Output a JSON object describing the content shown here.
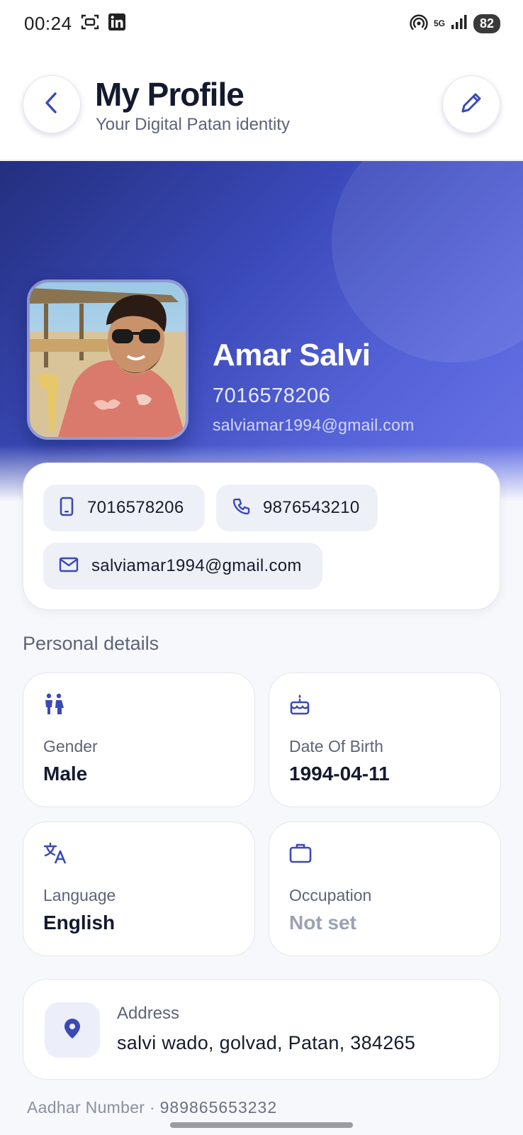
{
  "status_bar": {
    "time": "00:24",
    "network": "5G",
    "battery": "82"
  },
  "header": {
    "title": "My Profile",
    "subtitle": "Your Digital Patan identity",
    "back_icon": "chevron-left-icon",
    "edit_icon": "pencil-icon"
  },
  "profile": {
    "name": "Amar Salvi",
    "phone": "7016578206",
    "email": "salviamar1994@gmail.com"
  },
  "contacts": [
    {
      "icon": "smartphone-icon",
      "value": "7016578206"
    },
    {
      "icon": "phone-icon",
      "value": "9876543210"
    },
    {
      "icon": "mail-icon",
      "value": "salviamar1994@gmail.com"
    }
  ],
  "personal_details": {
    "title": "Personal details",
    "items": [
      {
        "icon": "gender-icon",
        "label": "Gender",
        "value": "Male"
      },
      {
        "icon": "cake-icon",
        "label": "Date Of Birth",
        "value": "1994-04-11"
      },
      {
        "icon": "translate-icon",
        "label": "Language",
        "value": "English"
      },
      {
        "icon": "briefcase-icon",
        "label": "Occupation",
        "value": "Not set"
      }
    ]
  },
  "address": {
    "icon": "location-pin-icon",
    "label": "Address",
    "value": "salvi wado, golvad, Patan, 384265"
  },
  "aadhar": {
    "label": "Aadhar Number",
    "separator": "·",
    "value": "989865653232"
  },
  "colors": {
    "accent": "#3a49b8",
    "hero_start": "#232f7e",
    "hero_end": "#6a74e8",
    "chip_bg": "#eef0f7"
  }
}
